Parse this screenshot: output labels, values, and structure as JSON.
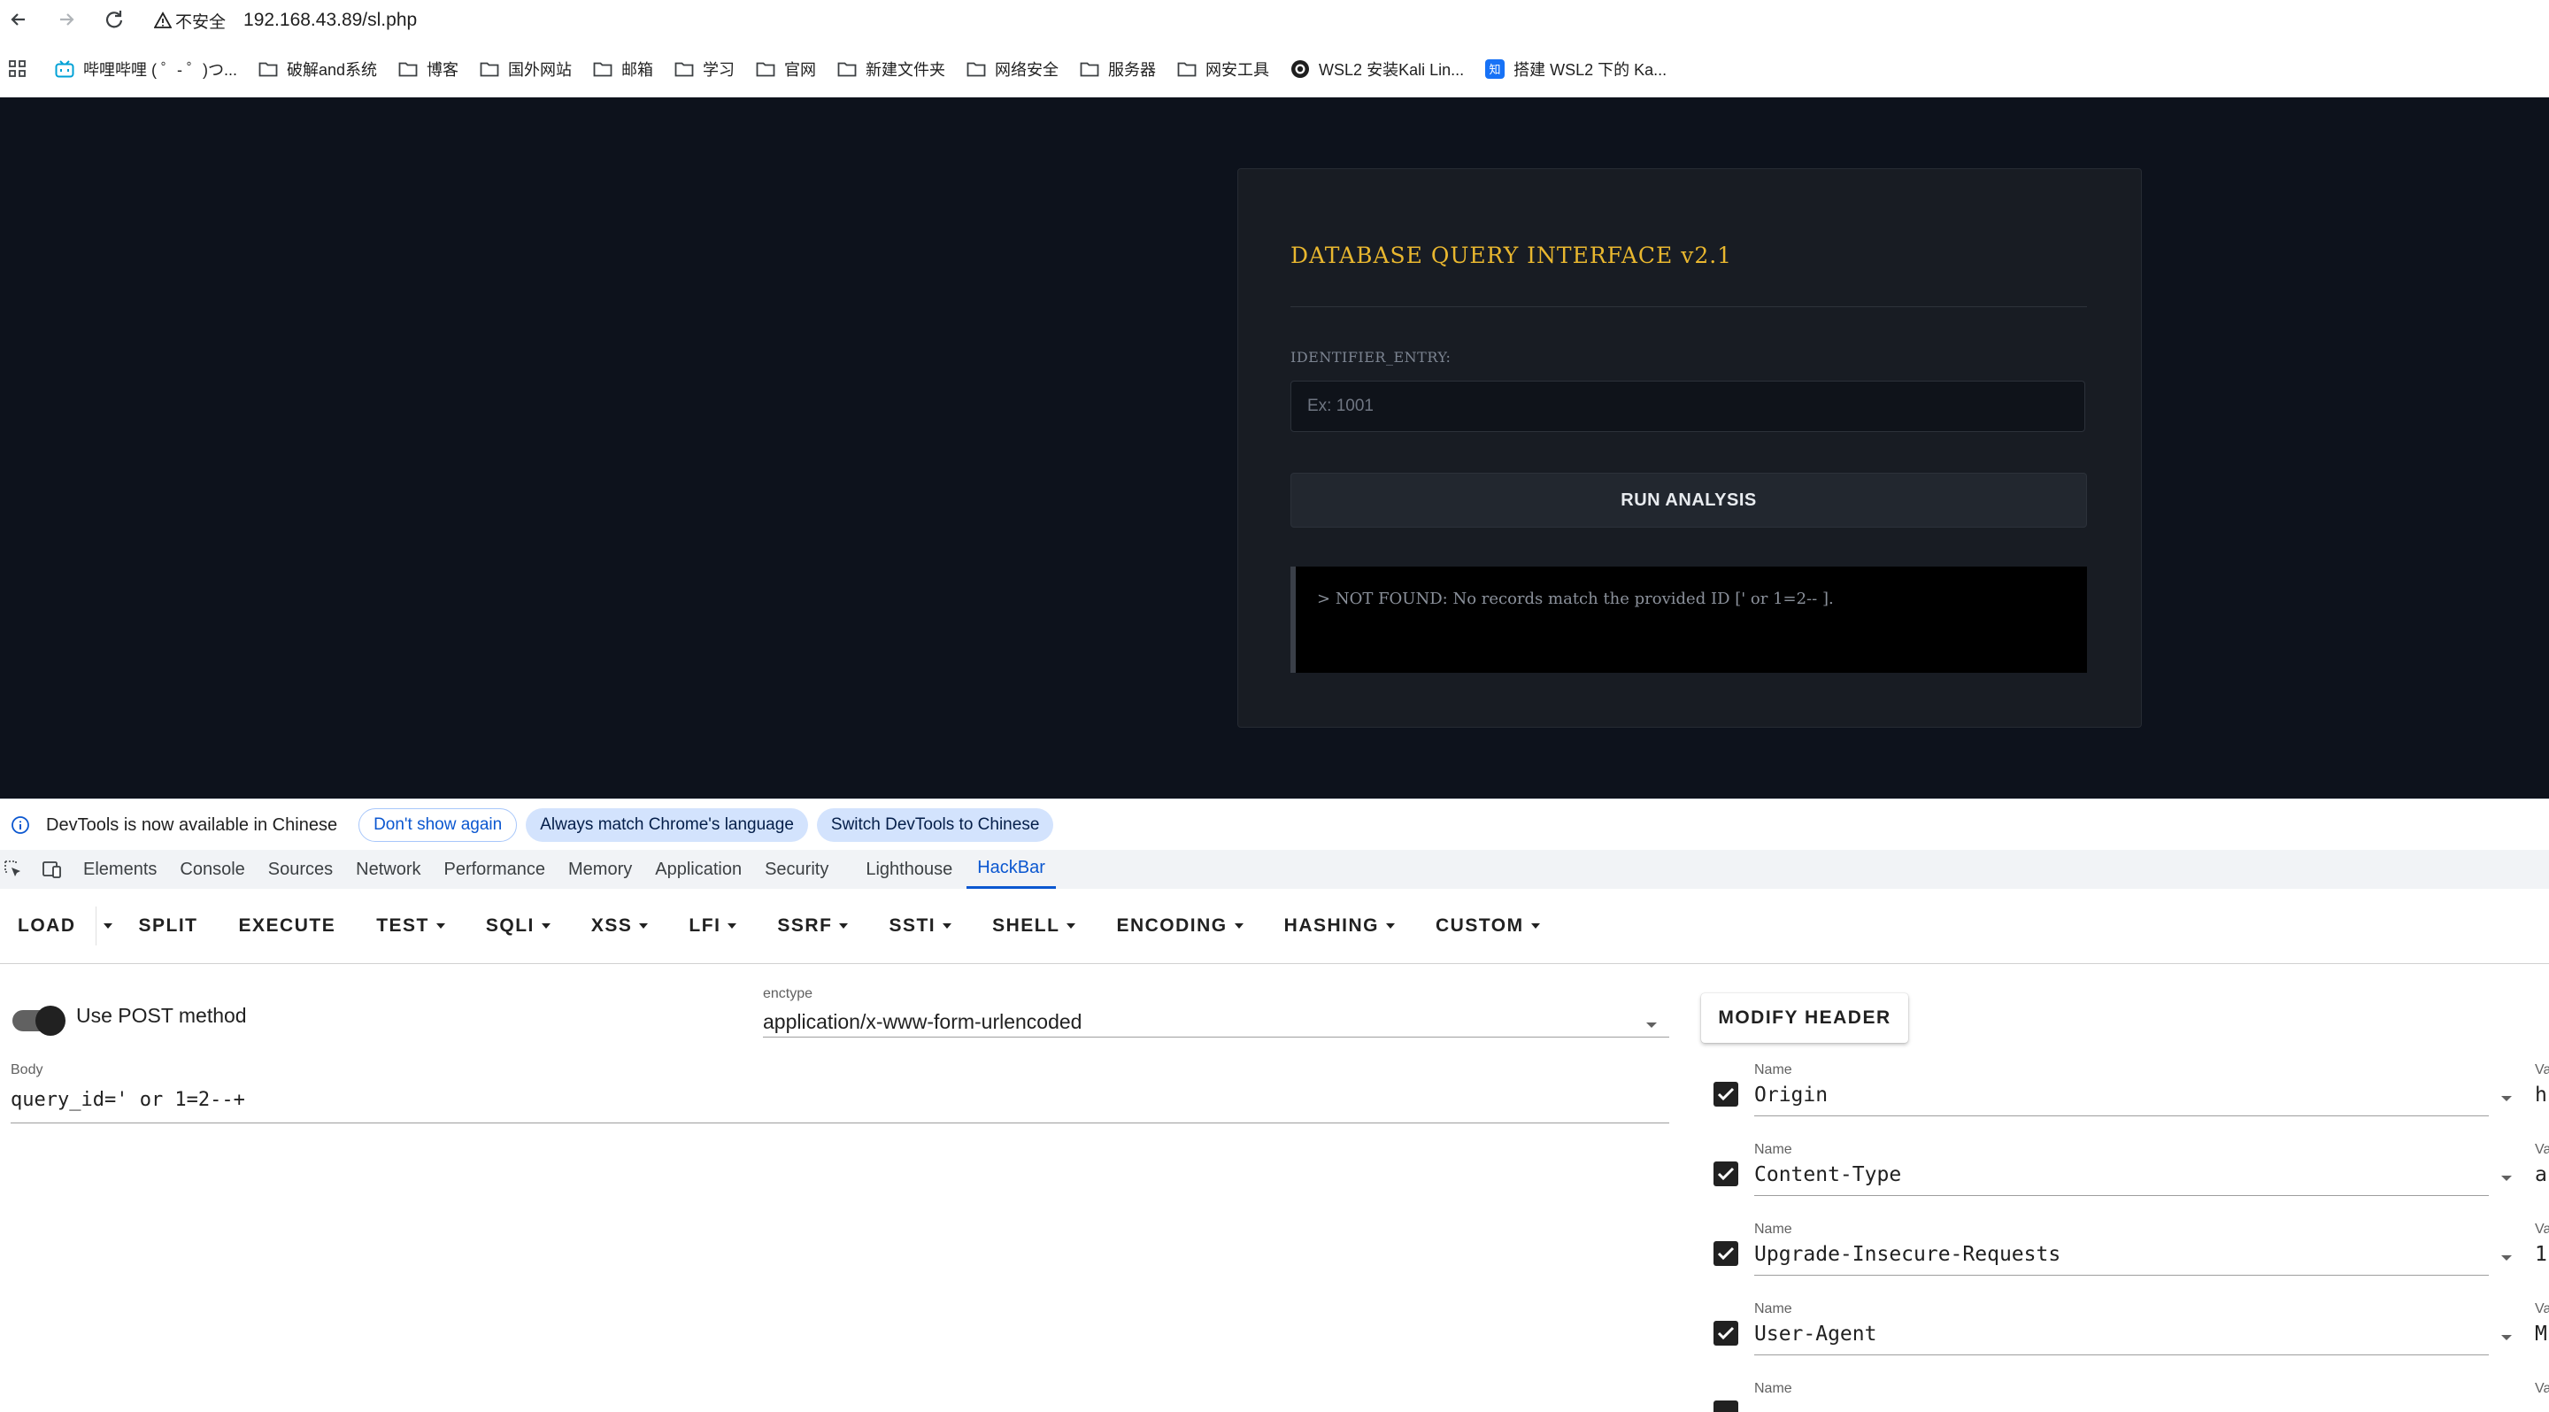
{
  "browser": {
    "security_label": "不安全",
    "url": "192.168.43.89/sl.php"
  },
  "bookmarks": [
    {
      "label": "哔哩哔哩 ( ゜- ゜)つ...",
      "icon": "bilibili-icon"
    },
    {
      "label": "破解and系统",
      "icon": "folder-icon"
    },
    {
      "label": "博客",
      "icon": "folder-icon"
    },
    {
      "label": "国外网站",
      "icon": "folder-icon"
    },
    {
      "label": "邮箱",
      "icon": "folder-icon"
    },
    {
      "label": "学习",
      "icon": "folder-icon"
    },
    {
      "label": "官网",
      "icon": "folder-icon"
    },
    {
      "label": "新建文件夹",
      "icon": "folder-icon"
    },
    {
      "label": "网络安全",
      "icon": "folder-icon"
    },
    {
      "label": "服务器",
      "icon": "folder-icon"
    },
    {
      "label": "网安工具",
      "icon": "folder-icon"
    },
    {
      "label": "WSL2 安装Kali Lin...",
      "icon": "github-icon"
    },
    {
      "label": "搭建 WSL2 下的 Ka...",
      "icon": "zhihu-icon"
    }
  ],
  "app": {
    "title": "DATABASE QUERY INTERFACE v2.1",
    "field_label": "IDENTIFIER_ENTRY:",
    "input_placeholder": "Ex: 1001",
    "input_value": "",
    "run_button": "RUN ANALYSIS",
    "result_prompt": ">",
    "result_text": "NOT FOUND: No records match the provided ID [' or 1=2-- ].",
    "colors": {
      "title": "#e9b72f",
      "background": "#0d121c",
      "card": "#181c23"
    }
  },
  "devtools": {
    "info_message": "DevTools is now available in Chinese",
    "info_buttons": [
      "Don't show again",
      "Always match Chrome's language",
      "Switch DevTools to Chinese"
    ],
    "tabs": [
      "Elements",
      "Console",
      "Sources",
      "Network",
      "Performance",
      "Memory",
      "Application",
      "Security",
      "Lighthouse",
      "HackBar"
    ],
    "active_tab": "HackBar"
  },
  "hackbar": {
    "menu": [
      "LOAD",
      "SPLIT",
      "EXECUTE",
      "TEST",
      "SQLI",
      "XSS",
      "LFI",
      "SSRF",
      "SSTI",
      "SHELL",
      "ENCODING",
      "HASHING",
      "CUSTOM"
    ],
    "use_post_label": "Use POST method",
    "use_post": true,
    "enctype_label": "enctype",
    "enctype_value": "application/x-www-form-urlencoded",
    "modify_header_button": "MODIFY HEADER",
    "body_label": "Body",
    "body_value": "query_id=' or 1=2--+",
    "headers": [
      {
        "name_label": "Name",
        "name": "Origin",
        "value_label": "Va",
        "value": "h",
        "checked": true
      },
      {
        "name_label": "Name",
        "name": "Content-Type",
        "value_label": "Va",
        "value": "a",
        "checked": true
      },
      {
        "name_label": "Name",
        "name": "Upgrade-Insecure-Requests",
        "value_label": "Va",
        "value": "1",
        "checked": true
      },
      {
        "name_label": "Name",
        "name": "User-Agent",
        "value_label": "Va",
        "value": "M",
        "checked": true
      },
      {
        "name_label": "Name",
        "name": "",
        "value_label": "Va",
        "value": "",
        "checked": true
      }
    ]
  }
}
